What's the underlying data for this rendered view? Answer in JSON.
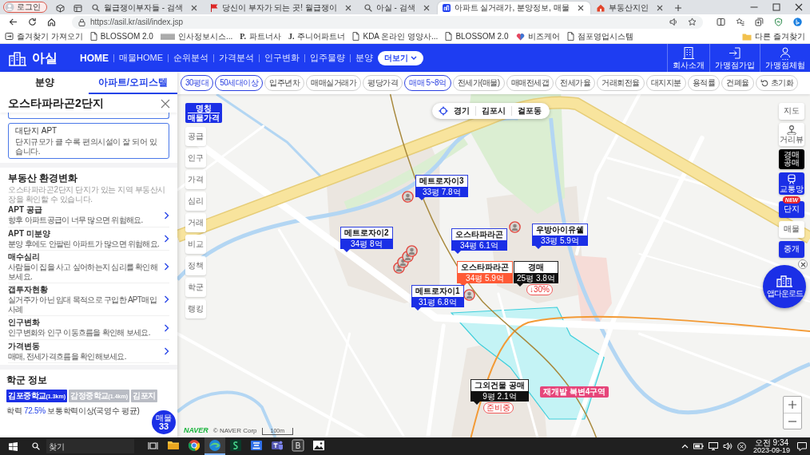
{
  "browser": {
    "profile": "로그인",
    "tabs": [
      {
        "title": "월급쟁이부자들 - 검색",
        "kind": "search",
        "selected": false
      },
      {
        "title": "당신이 부자가 되는 곳! 월급쟁이",
        "kind": "flag",
        "selected": false
      },
      {
        "title": "아실 - 검색",
        "kind": "search",
        "selected": false
      },
      {
        "title": "아파트 실거래가, 분양정보, 매물",
        "kind": "site",
        "selected": true
      },
      {
        "title": "부동산지인",
        "kind": "house",
        "selected": false
      }
    ],
    "url": "https://asil.kr/asil/index.jsp",
    "bookmarks": [
      {
        "label": "즐겨찾기 가져오기",
        "kind": "import"
      },
      {
        "label": "BLOSSOM 2.0",
        "kind": "page"
      },
      {
        "label": "인사정보시스...",
        "kind": "banner"
      },
      {
        "label": "파트너사",
        "kind": "letter",
        "glyph": "P."
      },
      {
        "label": "주니어파트너",
        "kind": "letter",
        "glyph": "J."
      },
      {
        "label": "KDA 온라인 영양사...",
        "kind": "page"
      },
      {
        "label": "BLOSSOM 2.0",
        "kind": "page"
      },
      {
        "label": "비즈케어",
        "kind": "heart"
      },
      {
        "label": "점포영업시스템",
        "kind": "page"
      }
    ],
    "other_bookmarks": "다른 즐겨찾기"
  },
  "header": {
    "logo": "아실",
    "nav": [
      {
        "label": "HOME",
        "selected": true
      },
      {
        "label": "매물HOME",
        "selected": false
      },
      {
        "label": "순위분석",
        "selected": false
      },
      {
        "label": "가격분석",
        "selected": false
      },
      {
        "label": "인구변화",
        "selected": false
      },
      {
        "label": "입주물량",
        "selected": false
      },
      {
        "label": "분양",
        "selected": false
      }
    ],
    "more": "더보기",
    "links": [
      {
        "label": "회사소개",
        "kind": "company"
      },
      {
        "label": "가맹점가입",
        "kind": "join"
      },
      {
        "label": "가맹점체험",
        "kind": "trial"
      }
    ]
  },
  "panel": {
    "tabs": [
      {
        "label": "분양",
        "selected": false
      },
      {
        "label": "아파트/오피스텔",
        "selected": true
      }
    ],
    "title": "오스타파라곤2단지",
    "cards": [
      {
        "title": "대단지 APT",
        "text": "단지규모가 클 수록 편의시설이 잘 되어 있습니다."
      }
    ],
    "environment": {
      "title": "부동산 환경변화",
      "subtitle": "오스타파라곤2단지 단지가 있는 지역 부동산시장을 확인할 수 있습니다.",
      "items": [
        {
          "title": "APT 공급",
          "text": "향후 아파트공급이 너무 많으면 위험해요."
        },
        {
          "title": "APT 미분양",
          "text": "분양 후에도 안팔린 아파트가 많으면 위험해요."
        },
        {
          "title": "매수심리",
          "text": "사람들이 집을 사고 싶어하는지 심리를 확인해 보세요."
        },
        {
          "title": "갭투자현황",
          "text": "실거주가 아닌 임대 목적으로 구입한 APT매입 사례"
        },
        {
          "title": "인구변화",
          "text": "인구변화와 인구 이동흐름을 확인해 보세요."
        },
        {
          "title": "가격변동",
          "text": "매매, 전세가격흐름을 확인해보세요."
        }
      ]
    },
    "school": {
      "title": "학군 정보",
      "chips": [
        {
          "name": "김포중학교",
          "distance": "(1.3km)",
          "selected": true
        },
        {
          "name": "감정중학교",
          "distance": "(1.4km)",
          "selected": false
        },
        {
          "name": "김포지",
          "selected": false
        }
      ],
      "stat": {
        "label": "학력",
        "value": "72.5%",
        "text": "보통학력이상(국영수 평균)"
      }
    },
    "listing_button": {
      "label": "매물",
      "count": "33"
    }
  },
  "filters": [
    {
      "label": "30평대",
      "kind": "filter",
      "selected": true
    },
    {
      "label": "50세대이상",
      "kind": "filter",
      "selected": true
    },
    {
      "label": "입주년차",
      "kind": "filter",
      "selected": false
    },
    {
      "label": "매매실거래가",
      "kind": "filter",
      "selected": false
    },
    {
      "label": "평당가격",
      "kind": "filter",
      "selected": false
    },
    {
      "label": "매매 5~8억",
      "kind": "filter",
      "selected": true
    },
    {
      "label": "전세가(매물)",
      "kind": "filter",
      "selected": false
    },
    {
      "label": "매매전세갭",
      "kind": "filter",
      "selected": false
    },
    {
      "label": "전세가율",
      "kind": "filter",
      "selected": false
    },
    {
      "label": "거래회전율",
      "kind": "filter",
      "selected": false
    },
    {
      "label": "대지지분",
      "kind": "filter",
      "selected": false
    },
    {
      "label": "용적률",
      "kind": "filter",
      "selected": false
    },
    {
      "label": "건폐율",
      "kind": "filter",
      "selected": false
    },
    {
      "label": "초기화",
      "kind": "reset",
      "selected": false
    }
  ],
  "map": {
    "mode_labels": [
      "명칭",
      "매물가격"
    ],
    "location": [
      "경기",
      "김포시",
      "걸포동"
    ],
    "left_menu": [
      "공급",
      "인구",
      "가격",
      "심리",
      "거래",
      "비교",
      "정책",
      "학군",
      "랭킹"
    ],
    "right_menu": [
      {
        "label": "지도",
        "kind": "map"
      },
      {
        "label": "거리뷰",
        "kind": "street-view"
      },
      {
        "label": "경매 공매",
        "kind": "auction"
      },
      {
        "label": "교통망",
        "kind": "transit"
      },
      {
        "label": "단지",
        "kind": "complex",
        "badge": "NEW"
      },
      {
        "label": "매물",
        "kind": "listing"
      },
      {
        "label": "중개",
        "kind": "broker"
      }
    ],
    "app_download": "앱다운로드",
    "markers": [
      {
        "title": "메트로자이3",
        "price": "33평 7.8억",
        "kind": "listing"
      },
      {
        "title": "메트로자이2",
        "price": "34평 8억",
        "kind": "listing"
      },
      {
        "title": "오스타파라곤",
        "price": "34평 6.1억",
        "kind": "listing"
      },
      {
        "title": "우방아이유쉘",
        "price": "33평 5.9억",
        "kind": "listing"
      },
      {
        "title": "오스타파라곤",
        "price": "34평 5.9억",
        "kind": "selected"
      },
      {
        "title": "경매",
        "price": "25평 3.8억",
        "kind": "auction",
        "badge": "↓30%"
      },
      {
        "title": "메트로자이1",
        "price": "31평 6.8억",
        "kind": "listing"
      },
      {
        "title": "그외건물 공매",
        "price": "9평 2.1억",
        "kind": "auction",
        "badge": "준비중"
      }
    ],
    "tags": [
      {
        "text": "재개발 북변4구역",
        "kind": "redevelopment"
      }
    ],
    "brand": "NAVER",
    "attribution": "© NAVER Corp",
    "scale": "100m"
  },
  "taskbar": {
    "search": {
      "placeholder": "찾기"
    },
    "apps": [
      {
        "kind": "folder",
        "selected": false
      },
      {
        "kind": "ring",
        "selected": false
      },
      {
        "kind": "swirl",
        "selected": true
      },
      {
        "kind": "s-tile",
        "selected": false
      },
      {
        "kind": "frame",
        "selected": false
      },
      {
        "kind": "people",
        "selected": false
      },
      {
        "kind": "b-tile",
        "selected": false
      },
      {
        "kind": "photos",
        "selected": false
      }
    ],
    "time": "오전 9:34",
    "date": "2023-09-19"
  }
}
